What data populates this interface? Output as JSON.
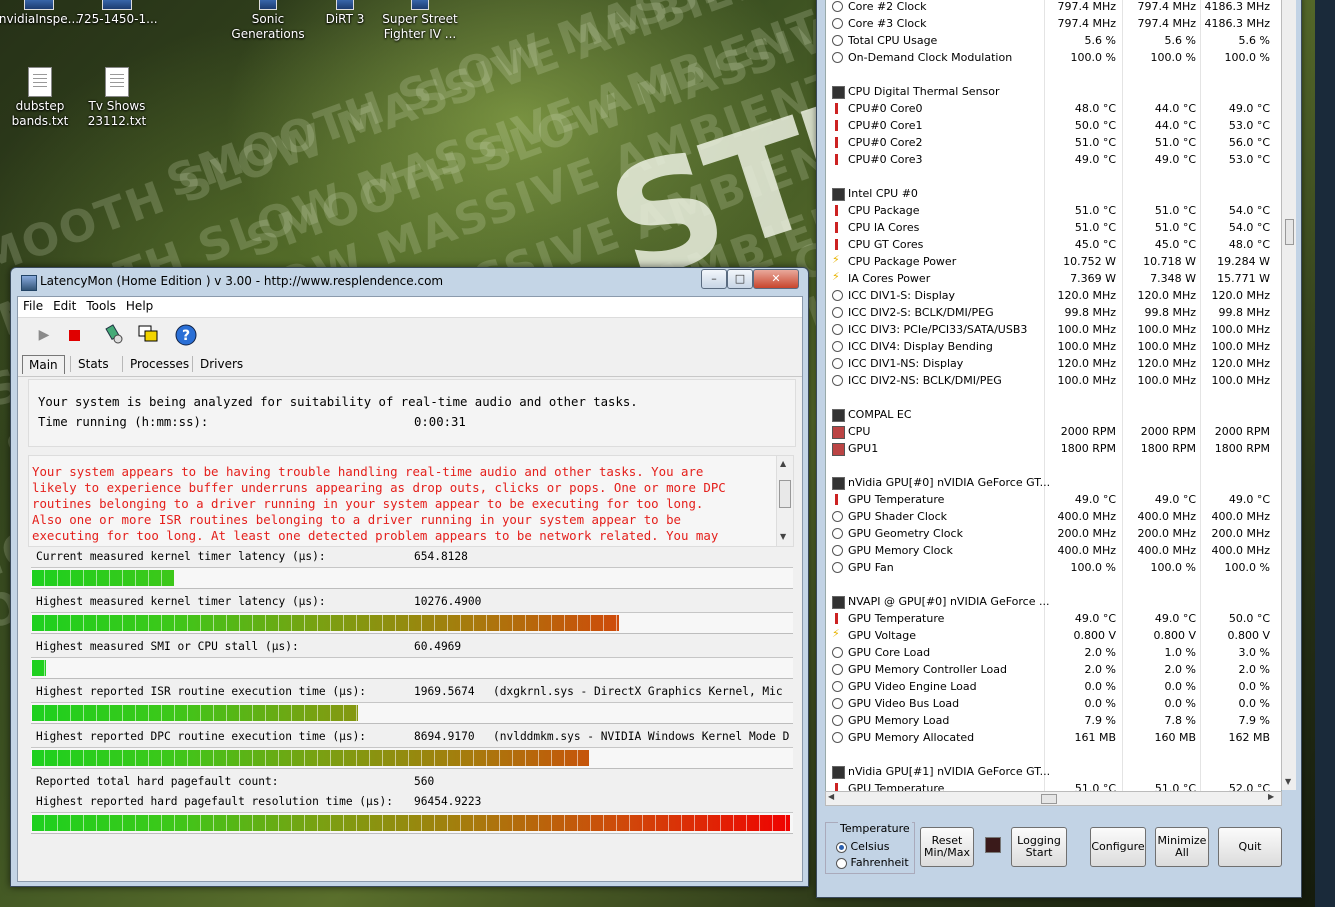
{
  "desktop": {
    "icons": [
      {
        "label": "nvidiaInspe..."
      },
      {
        "label": "725-1450-1..."
      },
      {
        "label": "Sonic Generations"
      },
      {
        "label": "DiRT 3"
      },
      {
        "label": "Super Street Fighter IV ..."
      },
      {
        "label": "dubstep bands.txt"
      },
      {
        "label": "Tv Shows 23112.txt"
      }
    ],
    "wallpaper_words": "SMOOTH SLOW MASSIVE AMBIENT CHILLING",
    "wallpaper_big": "STEP"
  },
  "latencymon": {
    "title": "LatencyMon  (Home Edition )  v 3.00 - http://www.resplendence.com",
    "menu": [
      "File",
      "Edit",
      "Tools",
      "Help"
    ],
    "tabs": [
      "Main",
      "Stats",
      "Processes",
      "Drivers"
    ],
    "analysis_line": "Your system is being analyzed for suitability of real-time audio and other tasks.",
    "time_label": "Time running (h:mm:ss):",
    "time_value": "0:00:31",
    "warning_lines": [
      "Your system appears to be having trouble handling real-time audio and other tasks. You are",
      "likely to experience buffer underruns appearing as drop outs, clicks or pops. One or more DPC",
      "routines belonging to a driver running in your system appear to be executing for too long.",
      "Also one or more ISR routines belonging to a driver running in your system appear to be",
      "executing for too long. At least one detected problem appears to be network related. You may"
    ],
    "metrics": [
      {
        "label": "Current measured kernel timer latency (µs):",
        "value": "654.8128",
        "extra": "",
        "level": 0.187
      },
      {
        "label": "Highest measured kernel timer latency (µs):",
        "value": "10276.4900",
        "extra": "",
        "level": 0.775
      },
      {
        "label": "Highest measured SMI or CPU stall (µs):",
        "value": "60.4969",
        "extra": "",
        "level": 0.018
      },
      {
        "label": "Highest reported ISR routine execution time (µs):",
        "value": "1969.5674",
        "extra": "(dxgkrnl.sys - DirectX Graphics Kernel, Mic",
        "level": 0.43
      },
      {
        "label": "Highest reported DPC routine execution time (µs):",
        "value": "8694.9170",
        "extra": "(nvlddmkm.sys - NVIDIA Windows Kernel Mode D",
        "level": 0.735
      }
    ],
    "pagefault_count_label": "Reported total hard pagefault count:",
    "pagefault_count_value": "560",
    "pagefault_res_label": "Highest reported hard pagefault resolution time (µs):",
    "pagefault_res_value": "96454.9223",
    "pagefault_level": 1.0
  },
  "hwinfo": {
    "rows": [
      {
        "type": "item",
        "icon": "clock",
        "name": "Core #2 Clock",
        "c": "797.4 MHz",
        "min": "797.4 MHz",
        "max": "4186.3 MHz"
      },
      {
        "type": "item",
        "icon": "clock",
        "name": "Core #3 Clock",
        "c": "797.4 MHz",
        "min": "797.4 MHz",
        "max": "4186.3 MHz"
      },
      {
        "type": "item",
        "icon": "clock",
        "name": "Total CPU Usage",
        "c": "5.6 %",
        "min": "5.6 %",
        "max": "5.6 %"
      },
      {
        "type": "item",
        "icon": "clock",
        "name": "On-Demand Clock Modulation",
        "c": "100.0 %",
        "min": "100.0 %",
        "max": "100.0 %"
      },
      {
        "type": "blank"
      },
      {
        "type": "group",
        "name": "CPU Digital Thermal Sensor"
      },
      {
        "type": "item",
        "icon": "therm",
        "name": "CPU#0 Core0",
        "c": "48.0 °C",
        "min": "44.0 °C",
        "max": "49.0 °C"
      },
      {
        "type": "item",
        "icon": "therm",
        "name": "CPU#0 Core1",
        "c": "50.0 °C",
        "min": "44.0 °C",
        "max": "53.0 °C"
      },
      {
        "type": "item",
        "icon": "therm",
        "name": "CPU#0 Core2",
        "c": "51.0 °C",
        "min": "51.0 °C",
        "max": "56.0 °C"
      },
      {
        "type": "item",
        "icon": "therm",
        "name": "CPU#0 Core3",
        "c": "49.0 °C",
        "min": "49.0 °C",
        "max": "53.0 °C"
      },
      {
        "type": "blank"
      },
      {
        "type": "group",
        "name": "Intel CPU #0"
      },
      {
        "type": "item",
        "icon": "therm",
        "name": "CPU Package",
        "c": "51.0 °C",
        "min": "51.0 °C",
        "max": "54.0 °C"
      },
      {
        "type": "item",
        "icon": "therm",
        "name": "CPU IA Cores",
        "c": "51.0 °C",
        "min": "51.0 °C",
        "max": "54.0 °C"
      },
      {
        "type": "item",
        "icon": "therm",
        "name": "CPU GT Cores",
        "c": "45.0 °C",
        "min": "45.0 °C",
        "max": "48.0 °C"
      },
      {
        "type": "item",
        "icon": "bolt",
        "name": "CPU Package Power",
        "c": "10.752 W",
        "min": "10.718 W",
        "max": "19.284 W"
      },
      {
        "type": "item",
        "icon": "bolt",
        "name": "IA Cores Power",
        "c": "7.369 W",
        "min": "7.348 W",
        "max": "15.771 W"
      },
      {
        "type": "item",
        "icon": "clock",
        "name": "ICC DIV1-S: Display",
        "c": "120.0 MHz",
        "min": "120.0 MHz",
        "max": "120.0 MHz"
      },
      {
        "type": "item",
        "icon": "clock",
        "name": "ICC DIV2-S: BCLK/DMI/PEG",
        "c": "99.8 MHz",
        "min": "99.8 MHz",
        "max": "99.8 MHz"
      },
      {
        "type": "item",
        "icon": "clock",
        "name": "ICC DIV3: PCIe/PCI33/SATA/USB3",
        "c": "100.0 MHz",
        "min": "100.0 MHz",
        "max": "100.0 MHz"
      },
      {
        "type": "item",
        "icon": "clock",
        "name": "ICC DIV4: Display Bending",
        "c": "100.0 MHz",
        "min": "100.0 MHz",
        "max": "100.0 MHz"
      },
      {
        "type": "item",
        "icon": "clock",
        "name": "ICC DIV1-NS: Display",
        "c": "120.0 MHz",
        "min": "120.0 MHz",
        "max": "120.0 MHz"
      },
      {
        "type": "item",
        "icon": "clock",
        "name": "ICC DIV2-NS: BCLK/DMI/PEG",
        "c": "100.0 MHz",
        "min": "100.0 MHz",
        "max": "100.0 MHz"
      },
      {
        "type": "blank"
      },
      {
        "type": "group",
        "name": "COMPAL EC"
      },
      {
        "type": "item",
        "icon": "fan",
        "name": "CPU",
        "c": "2000 RPM",
        "min": "2000 RPM",
        "max": "2000 RPM"
      },
      {
        "type": "item",
        "icon": "fan",
        "name": "GPU1",
        "c": "1800 RPM",
        "min": "1800 RPM",
        "max": "1800 RPM"
      },
      {
        "type": "blank"
      },
      {
        "type": "group",
        "name": "nVidia GPU[#0] nVIDIA GeForce GT..."
      },
      {
        "type": "item",
        "icon": "therm",
        "name": "GPU Temperature",
        "c": "49.0 °C",
        "min": "49.0 °C",
        "max": "49.0 °C"
      },
      {
        "type": "item",
        "icon": "clock",
        "name": "GPU Shader Clock",
        "c": "400.0 MHz",
        "min": "400.0 MHz",
        "max": "400.0 MHz"
      },
      {
        "type": "item",
        "icon": "clock",
        "name": "GPU Geometry Clock",
        "c": "200.0 MHz",
        "min": "200.0 MHz",
        "max": "200.0 MHz"
      },
      {
        "type": "item",
        "icon": "clock",
        "name": "GPU Memory Clock",
        "c": "400.0 MHz",
        "min": "400.0 MHz",
        "max": "400.0 MHz"
      },
      {
        "type": "item",
        "icon": "clock",
        "name": "GPU Fan",
        "c": "100.0 %",
        "min": "100.0 %",
        "max": "100.0 %"
      },
      {
        "type": "blank"
      },
      {
        "type": "group",
        "name": "NVAPI @ GPU[#0] nVIDIA GeForce ..."
      },
      {
        "type": "item",
        "icon": "therm",
        "name": "GPU Temperature",
        "c": "49.0 °C",
        "min": "49.0 °C",
        "max": "50.0 °C"
      },
      {
        "type": "item",
        "icon": "bolt",
        "name": "GPU Voltage",
        "c": "0.800 V",
        "min": "0.800 V",
        "max": "0.800 V"
      },
      {
        "type": "item",
        "icon": "clock",
        "name": "GPU Core Load",
        "c": "2.0 %",
        "min": "1.0 %",
        "max": "3.0 %"
      },
      {
        "type": "item",
        "icon": "clock",
        "name": "GPU Memory Controller Load",
        "c": "2.0 %",
        "min": "2.0 %",
        "max": "2.0 %"
      },
      {
        "type": "item",
        "icon": "clock",
        "name": "GPU Video Engine Load",
        "c": "0.0 %",
        "min": "0.0 %",
        "max": "0.0 %"
      },
      {
        "type": "item",
        "icon": "clock",
        "name": "GPU Video Bus Load",
        "c": "0.0 %",
        "min": "0.0 %",
        "max": "0.0 %"
      },
      {
        "type": "item",
        "icon": "clock",
        "name": "GPU Memory Load",
        "c": "7.9 %",
        "min": "7.8 %",
        "max": "7.9 %"
      },
      {
        "type": "item",
        "icon": "clock",
        "name": "GPU Memory Allocated",
        "c": "161 MB",
        "min": "160 MB",
        "max": "162 MB"
      },
      {
        "type": "blank"
      },
      {
        "type": "group",
        "name": "nVidia GPU[#1] nVIDIA GeForce GT..."
      },
      {
        "type": "item",
        "icon": "therm",
        "name": "GPU Temperature",
        "c": "51.0 °C",
        "min": "51.0 °C",
        "max": "52.0 °C"
      }
    ],
    "temperature_group": "Temperature",
    "celsius": "Celsius",
    "fahrenheit": "Fahrenheit",
    "buttons": {
      "reset": "Reset Min/Max",
      "logging": "Logging Start",
      "configure": "Configure",
      "minimize": "Minimize All",
      "quit": "Quit"
    }
  }
}
